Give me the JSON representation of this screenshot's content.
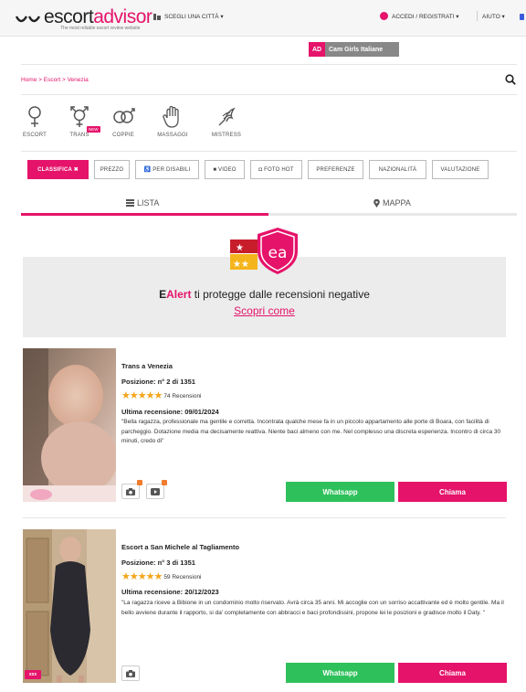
{
  "header": {
    "logo_word_prefix": "escort",
    "logo_word_accent": "advisor",
    "tagline": "The most reliable escort review website",
    "city_select": "SCEGLI UNA CITTÀ ▾",
    "account": "ACCEDI  / REGISTRATI ▾",
    "help": "AIUTO ▾"
  },
  "ad_banner": {
    "badge": "AD",
    "label": "Cam Girls Italiane"
  },
  "breadcrumb": "Home > Escort > Venezia",
  "categories": [
    {
      "label": "ESCORT",
      "icon": "female-icon"
    },
    {
      "label": "TRANS",
      "icon": "trans-icon",
      "badge": "NEW"
    },
    {
      "label": "COPPIE",
      "icon": "couple-icon"
    },
    {
      "label": "MASSAGGI",
      "icon": "hand-icon"
    },
    {
      "label": "MISTRESS",
      "icon": "whip-icon"
    }
  ],
  "filters": [
    {
      "label": "CLASSIFICA ✖",
      "active": true
    },
    {
      "label": "PREZZO"
    },
    {
      "label": "♿ PER DISABILI"
    },
    {
      "label": "■ VIDEO"
    },
    {
      "label": "◘ FOTO HOT"
    },
    {
      "label": "PREFERENZE"
    },
    {
      "label": "NAZIONALITÀ"
    },
    {
      "label": "VALUTAZIONE"
    }
  ],
  "tabs": {
    "list": "LISTA",
    "map": "MAPPA"
  },
  "ealert": {
    "lead_bold": "E",
    "lead_accent": "Alert",
    "text": " ti protegge dalle recensioni negative",
    "link": "Scopri come"
  },
  "listings": [
    {
      "title": "Trans a Venezia",
      "position": "Posizione: n° 2 di 1351",
      "stars": "★★★★★",
      "reviews": "74 Recensioni",
      "last_review": "Ultima recensione: 09/01/2024",
      "review_text": "\"Bella ragazza, professionale ma gentile e corretta. Incontrata qualche mese fa in un piccolo appartamento alle porte di Boara, con facilità di parcheggio. Dotazione media ma decisamente reattiva. Niente baci almeno con me. Nel complesso una discreta esperienza. Incontro di circa 30 minuti, credo di\"",
      "watermark": "escortadvisor",
      "whatsapp": "Whatsapp",
      "call": "Chiama"
    },
    {
      "title": "Escort a San Michele al Tagliamento",
      "position": "Posizione: n° 3 di 1351",
      "stars": "★★★★★",
      "reviews": "59 Recensioni",
      "last_review": "Ultima recensione: 20/12/2023",
      "review_text": "\"La ragazza riceve a Bibione in un condominio molto riservato. Avrà circa 35 anni. Mi accoglie con un sorriso accattivante ed è molto gentile. Ma il bello avviene durante il rapporto, si da' completamente con abbracci e baci profondissini, propone lei le posizioni e gradisce molto il Daty. \"",
      "watermark": "escortadvisor",
      "badge": "xxx",
      "whatsapp": "Whatsapp",
      "call": "Chiama"
    }
  ],
  "colors": {
    "brand": "#e5136a",
    "whatsapp": "#2ec15b",
    "star": "#f3a51b",
    "alert_bg": "#ececec"
  }
}
